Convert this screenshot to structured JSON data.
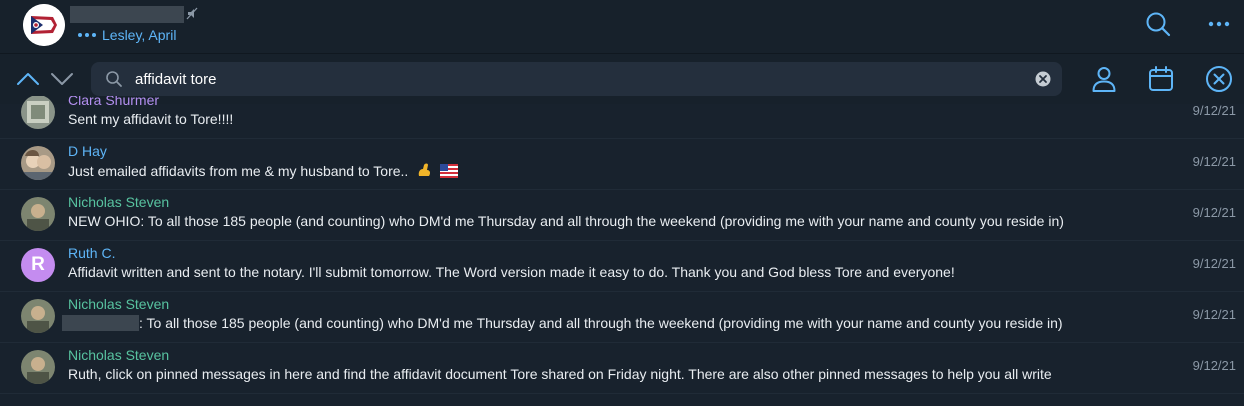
{
  "header": {
    "status_text": "Lesley, April"
  },
  "search": {
    "query": "affidavit tore"
  },
  "results": [
    {
      "name": "Clara Shurmer",
      "name_color": "#b38ff0",
      "text": "Sent my affidavit to Tore!!!!",
      "date": "9/12/21",
      "avatar": "photo"
    },
    {
      "name": "D Hay",
      "name_color": "#5eb5f7",
      "text": "Just emailed affidavits from me & my husband to Tore..",
      "emoji": [
        "flexed-biceps",
        "us-flag"
      ],
      "date": "9/12/21",
      "avatar": "photo"
    },
    {
      "name": "Nicholas Steven",
      "name_color": "#58c3a0",
      "text": "NEW OHIO: To all those 185 people (and counting) who DM'd me Thursday and all through the weekend (providing me with your name and county you reside in)",
      "date": "9/12/21",
      "avatar": "photo"
    },
    {
      "name": "Ruth C.",
      "name_color": "#5eb5f7",
      "text": "Affidavit written and sent to the notary. I'll submit tomorrow. The Word version made it easy to do.  Thank you and God bless Tore and everyone!",
      "date": "9/12/21",
      "avatar": "letter",
      "avatar_letter": "R",
      "avatar_color": "#c48cf0"
    },
    {
      "name": "Nicholas Steven",
      "name_color": "#58c3a0",
      "text": ": To all those 185 people (and counting) who DM'd me Thursday and all through the weekend (providing me with your name and county you reside in)",
      "redacted_prefix": true,
      "date": "9/12/21",
      "avatar": "photo"
    },
    {
      "name": "Nicholas Steven",
      "name_color": "#58c3a0",
      "text": "Ruth, click on pinned messages in here and find the affidavit document Tore shared on Friday night. There are also other pinned messages to help you all write",
      "date": "9/12/21",
      "avatar": "photo"
    }
  ],
  "colors": {
    "accent": "#5eb5f7",
    "background": "#18222d",
    "header": "#17212b",
    "search_field": "#242f3d"
  }
}
